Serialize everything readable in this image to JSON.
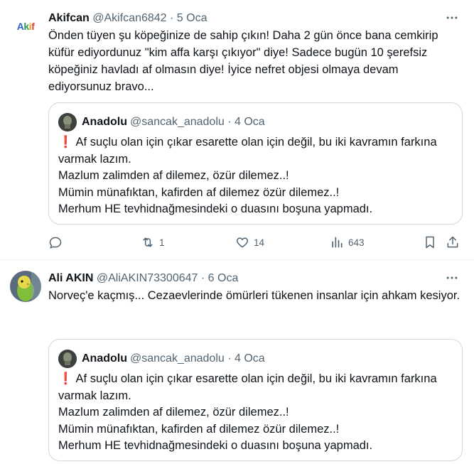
{
  "tweets": [
    {
      "avatar_logo": "Akif",
      "name": "Akifcan",
      "handle": "@Akifcan6842",
      "date": "5 Oca",
      "text": "Önden tüyen şu köpeğinize de sahip çıkın! Daha 2 gün önce bana cemkirip küfür ediyordunuz \"kim affa karşı çıkıyor\" diye! Sadece bugün 10 şerefsiz köpeğiniz havladı af olmasın diye! İyice nefret objesi olmaya devam ediyorsunuz bravo...",
      "actions": {
        "replies": "",
        "retweets": "1",
        "likes": "14",
        "views": "643"
      }
    },
    {
      "name": "Ali AKIN",
      "handle": "@AliAKIN73300647",
      "date": "6 Oca",
      "text": "Norveç'e kaçmış... Cezaevlerinde ömürleri tükenen insanlar için ahkam kesiyor."
    }
  ],
  "quote": {
    "name": "Anadolu",
    "handle": "@sancak_anadolu",
    "date": "4 Oca",
    "text": "Af suçlu olan için çıkar esarette olan için değil, bu iki kavramın farkına varmak lazım.\nMazlum zalimden af dilemez, özür dilemez..!\nMümin münafıktan, kafirden af dilemez özür dilemez..!\nMerhum HE tevhidnağmesindeki o duasını boşuna yapmadı."
  },
  "separator": "·",
  "icons": {
    "more": "more-horizontal-icon",
    "reply": "reply-icon",
    "retweet": "retweet-icon",
    "like": "heart-icon",
    "views": "views-icon",
    "bookmark": "bookmark-icon",
    "share": "share-icon",
    "excl": "red-exclamation-icon"
  },
  "colors": {
    "text": "#0f1419",
    "secondary": "#536471",
    "border": "#cfd9de",
    "exclamation": "#e0245e"
  }
}
